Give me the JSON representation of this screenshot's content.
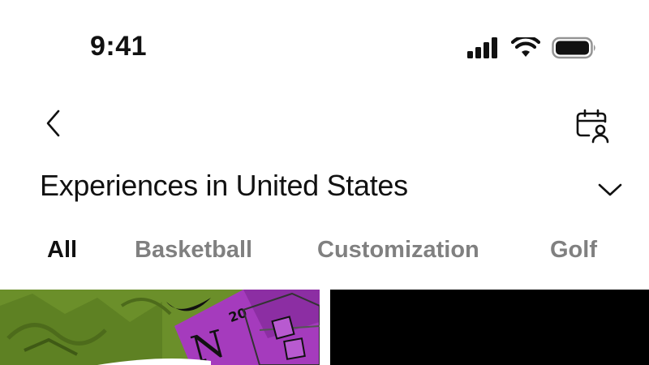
{
  "status_bar": {
    "time": "9:41",
    "icons": [
      "cellular-signal-icon",
      "wifi-icon",
      "battery-icon"
    ]
  },
  "nav": {
    "back_icon": "chevron-left-icon",
    "calendar_icon": "calendar-user-icon"
  },
  "header": {
    "title": "Experiences in United States",
    "dropdown_icon": "chevron-down-icon"
  },
  "tabs": [
    {
      "label": "All",
      "active": true
    },
    {
      "label": "Basketball",
      "active": false
    },
    {
      "label": "Customization",
      "active": false
    },
    {
      "label": "Golf",
      "active": false
    }
  ],
  "cards": [
    {
      "number_art": "20",
      "letter_art": "N"
    },
    {}
  ],
  "colors": {
    "text_primary": "#111111",
    "text_secondary": "#808080",
    "background": "#ffffff",
    "art_green": "#6b8f2a",
    "art_purple": "#a53bbd"
  }
}
